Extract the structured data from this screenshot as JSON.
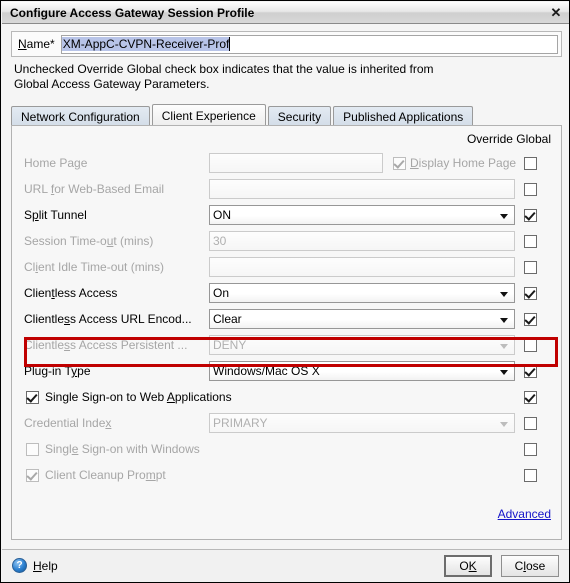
{
  "window": {
    "title": "Configure Access Gateway Session Profile",
    "close_icon": "close-icon",
    "close_glyph": "✕"
  },
  "name_row": {
    "label_pre": "N",
    "label_mnemonic": "a",
    "label_post": "me*",
    "label_full": "Name*",
    "value": "XM-AppC-CVPN-Receiver-Prof"
  },
  "hint": {
    "line1": "Unchecked Override Global check box indicates that the value is inherited from",
    "line2": "Global Access Gateway Parameters."
  },
  "tabs": [
    {
      "label": "Network Configuration",
      "active": false
    },
    {
      "label": "Client Experience",
      "active": true
    },
    {
      "label": "Security",
      "active": false
    },
    {
      "label": "Published Applications",
      "active": false
    }
  ],
  "panel": {
    "override_header": "Override Global",
    "advanced_link": "Advanced",
    "rows": [
      {
        "type": "text",
        "label": "Home Page",
        "mnemonic": "g",
        "value": "",
        "disabled": true,
        "override": false,
        "extra_checkbox": {
          "label": "Display Home Page",
          "mnemonic": "D",
          "checked": true,
          "disabled": true
        }
      },
      {
        "type": "text",
        "label": "URL for Web-Based Email",
        "mnemonic": "f",
        "value": "",
        "disabled": true,
        "override": false
      },
      {
        "type": "dropdown",
        "label": "Split Tunnel",
        "mnemonic": "p",
        "value": "ON",
        "disabled": false,
        "override": true,
        "highlighted": true
      },
      {
        "type": "text",
        "label": "Session Time-out (mins)",
        "mnemonic": "u",
        "value": "30",
        "disabled": true,
        "override": false
      },
      {
        "type": "text",
        "label": "Client Idle Time-out (mins)",
        "mnemonic": "i",
        "value": "",
        "disabled": true,
        "override": false
      },
      {
        "type": "dropdown",
        "label": "Clientless Access",
        "mnemonic": "t",
        "value": "On",
        "disabled": false,
        "override": true
      },
      {
        "type": "dropdown",
        "label": "Clientless Access URL Encod...",
        "mnemonic": "s",
        "value": "Clear",
        "disabled": false,
        "override": true
      },
      {
        "type": "dropdown",
        "label": "Clientless Access Persistent ...",
        "mnemonic": "s",
        "value": "DENY",
        "disabled": true,
        "override": false
      },
      {
        "type": "dropdown",
        "label": "Plug-in Type",
        "mnemonic": "y",
        "value": "Windows/Mac OS X",
        "disabled": false,
        "override": true
      },
      {
        "type": "checkbox",
        "label": "Single Sign-on to Web Applications",
        "mnemonic": "A",
        "checked": true,
        "disabled": false,
        "override": true
      },
      {
        "type": "dropdown",
        "label": "Credential Index",
        "mnemonic": "x",
        "value": "PRIMARY",
        "disabled": true,
        "override": false
      },
      {
        "type": "checkbox",
        "label": "Single Sign-on with Windows",
        "mnemonic": "e",
        "checked": false,
        "disabled": true,
        "override": false
      },
      {
        "type": "checkbox",
        "label": "Client Cleanup Prompt",
        "mnemonic": "m",
        "checked": true,
        "disabled": true,
        "override": false
      }
    ]
  },
  "footer": {
    "help_label": "Help",
    "help_icon": "question-mark-icon",
    "help_glyph": "?",
    "ok_label": "OK",
    "close_label": "Close"
  },
  "colors": {
    "highlight_red": "#c00000",
    "link_blue": "#1414c8",
    "selection_blue": "#b8c4e8",
    "panel_bg": "#f7f7f7",
    "dialog_bg": "#f5f5f5"
  }
}
